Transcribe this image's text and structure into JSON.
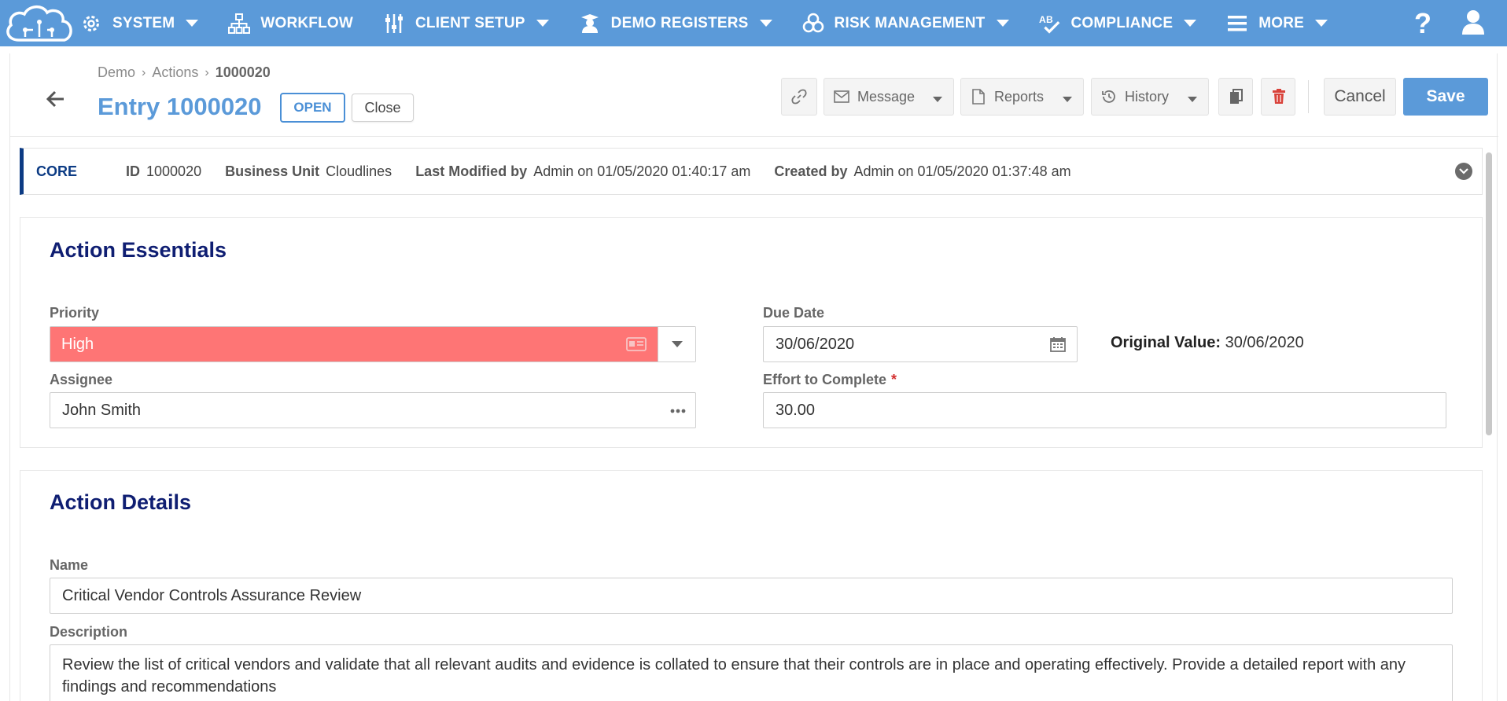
{
  "nav": {
    "items": [
      {
        "label": "SYSTEM",
        "icon": "gear-icon"
      },
      {
        "label": "WORKFLOW",
        "icon": "sitemap-icon"
      },
      {
        "label": "CLIENT SETUP",
        "icon": "sliders-icon"
      },
      {
        "label": "DEMO REGISTERS",
        "icon": "graduate-icon"
      },
      {
        "label": "RISK MANAGEMENT",
        "icon": "biohazard-icon"
      },
      {
        "label": "COMPLIANCE",
        "icon": "spellcheck-icon"
      },
      {
        "label": "MORE",
        "icon": "menu-icon"
      }
    ],
    "help": "?"
  },
  "breadcrumb": {
    "items": [
      "Demo",
      "Actions"
    ],
    "current": "1000020"
  },
  "header": {
    "title": "Entry 1000020",
    "status": "OPEN",
    "close_label": "Close"
  },
  "toolbar": {
    "message_label": "Message",
    "reports_label": "Reports",
    "history_label": "History",
    "cancel_label": "Cancel",
    "save_label": "Save"
  },
  "core": {
    "label": "CORE",
    "id_label": "ID",
    "id_value": "1000020",
    "bu_label": "Business Unit",
    "bu_value": "Cloudlines",
    "modified_label": "Last Modified by",
    "modified_value": "Admin on 01/05/2020 01:40:17 am",
    "created_label": "Created by",
    "created_value": "Admin on 01/05/2020 01:37:48 am"
  },
  "essentials": {
    "title": "Action Essentials",
    "priority_label": "Priority",
    "priority_value": "High",
    "due_label": "Due Date",
    "due_value": "30/06/2020",
    "original_label": "Original Value:",
    "original_value": "30/06/2020",
    "assignee_label": "Assignee",
    "assignee_value": "John Smith",
    "effort_label": "Effort to Complete",
    "effort_required": "*",
    "effort_value": "30.00"
  },
  "details": {
    "title": "Action Details",
    "name_label": "Name",
    "name_value": "Critical Vendor Controls Assurance Review",
    "desc_label": "Description",
    "desc_value": "Review the list of critical vendors and validate that all relevant audits and evidence is collated to ensure that their controls are in place and operating effectively. Provide a detailed report with any findings and recommendations"
  },
  "colors": {
    "nav": "#5b9ad9",
    "priority_high": "#fe7575",
    "section_title": "#0f1e72",
    "delete": "#d9423a"
  }
}
